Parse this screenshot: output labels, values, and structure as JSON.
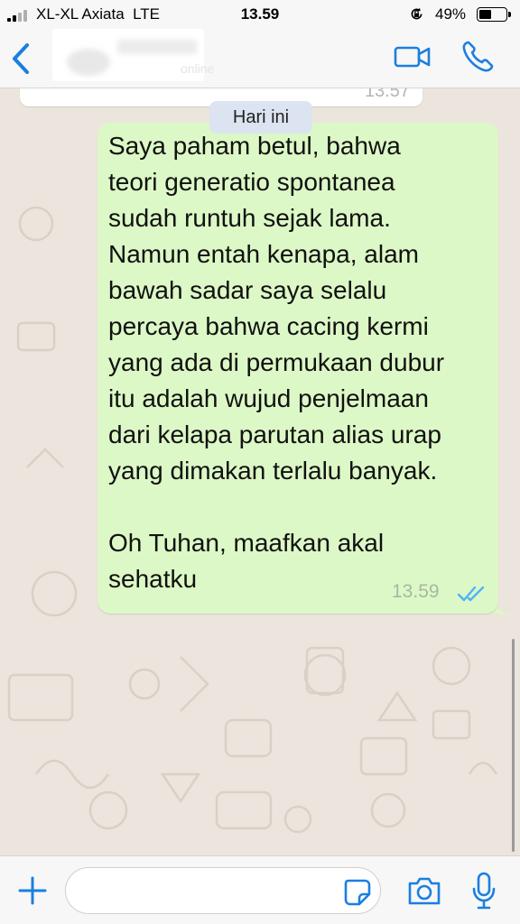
{
  "status_bar": {
    "carrier": "XL-XL Axiata",
    "network": "LTE",
    "time": "13.59",
    "battery": "49%",
    "battery_level": 0.49
  },
  "header": {
    "contact_status": "online",
    "back_icon": "chevron-left-icon",
    "video_icon": "video-camera-icon",
    "call_icon": "phone-icon"
  },
  "chat": {
    "previous_message_time": "13.57",
    "date_label": "Hari ini",
    "message": {
      "text": "Saya paham betul, bahwa\nteori generatio spontanea\nsudah runtuh sejak lama.\nNamun entah kenapa, alam\nbawah sadar saya selalu\npercaya bahwa cacing kermi\nyang ada di permukaan dubur\nitu adalah wujud penjelmaan\ndari kelapa parutan alias urap\nyang dimakan terlalu banyak.\n\nOh Tuhan, maafkan akal\nsehatku",
      "time": "13.59",
      "status_icon": "double-check-read-icon"
    }
  },
  "input_bar": {
    "value": "",
    "plus_icon": "plus-icon",
    "sticker_icon": "sticker-icon",
    "camera_icon": "camera-icon",
    "mic_icon": "microphone-icon"
  },
  "colors": {
    "accent": "#1a7fe0",
    "outgoing_bubble": "#dcf8c6",
    "chat_background": "#ece5dd",
    "date_chip": "#dbe4f0",
    "read_ticks": "#4fb3f6"
  }
}
